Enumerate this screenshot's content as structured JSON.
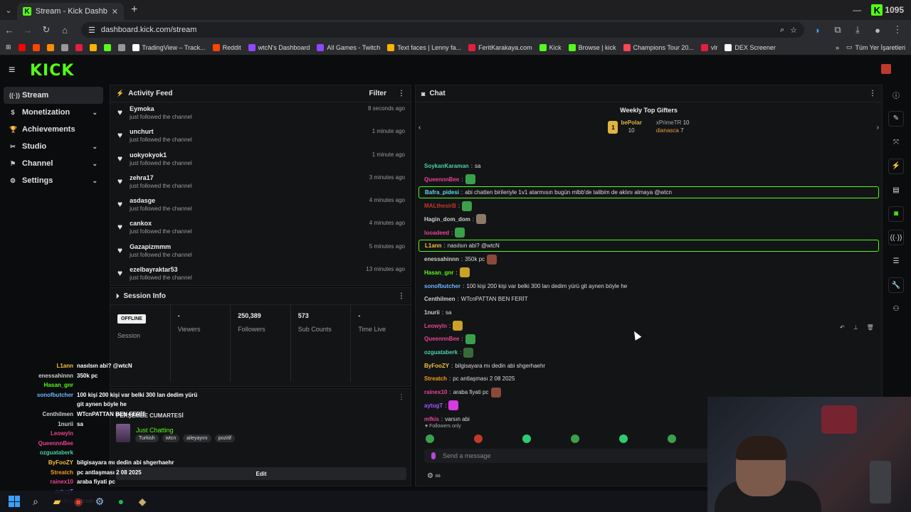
{
  "browser": {
    "tab_title": "Stream - Kick Dashboard",
    "url": "dashboard.kick.com/stream",
    "overlay_counter": "1095",
    "bookmarks": [
      {
        "label": "",
        "color": "#ff0000"
      },
      {
        "label": "",
        "color": "#ff4500"
      },
      {
        "label": "",
        "color": "#ff8c00"
      },
      {
        "label": "",
        "color": "#999999"
      },
      {
        "label": "",
        "color": "#e41e3f"
      },
      {
        "label": "",
        "color": "#f7b500"
      },
      {
        "label": "",
        "color": "#53fc18"
      },
      {
        "label": "",
        "color": "#999999"
      },
      {
        "label": "TradingView – Track...",
        "color": "#ffffff"
      },
      {
        "label": "Reddit",
        "color": "#ff4500"
      },
      {
        "label": "wtcN's Dashboard",
        "color": "#9146ff"
      },
      {
        "label": "All Games - Twitch",
        "color": "#9146ff"
      },
      {
        "label": "Text faces | Lenny fa...",
        "color": "#f7b500"
      },
      {
        "label": "FeritKarakaya.com",
        "color": "#e41e3f"
      },
      {
        "label": "Kick",
        "color": "#53fc18"
      },
      {
        "label": "Browse | kick",
        "color": "#53fc18"
      },
      {
        "label": "Champions Tour 20...",
        "color": "#ff4655"
      },
      {
        "label": "vlr",
        "color": "#e41e3f"
      },
      {
        "label": "DEX Screener",
        "color": "#ffffff"
      }
    ],
    "all_bookmarks": "Tüm Yer İşaretleri"
  },
  "kick": {
    "logo": "KICK"
  },
  "sidebar": {
    "items": [
      {
        "label": "Stream",
        "active": true,
        "chevron": false,
        "icon": "broadcast-icon"
      },
      {
        "label": "Monetization",
        "active": false,
        "chevron": true,
        "icon": "money-icon"
      },
      {
        "label": "Achievements",
        "active": false,
        "chevron": false,
        "icon": "trophy-icon"
      },
      {
        "label": "Studio",
        "active": false,
        "chevron": true,
        "icon": "tools-icon"
      },
      {
        "label": "Channel",
        "active": false,
        "chevron": true,
        "icon": "flag-icon"
      },
      {
        "label": "Settings",
        "active": false,
        "chevron": true,
        "icon": "gear-icon"
      }
    ]
  },
  "activity": {
    "title": "Activity Feed",
    "filter_label": "Filter",
    "rows": [
      {
        "user": "Eymoka",
        "action": "just followed the channel",
        "time": "8 seconds ago"
      },
      {
        "user": "unchurt",
        "action": "just followed the channel",
        "time": "1 minute ago"
      },
      {
        "user": "uokyokyok1",
        "action": "just followed the channel",
        "time": "1 minute ago"
      },
      {
        "user": "zehra17",
        "action": "just followed the channel",
        "time": "3 minutes ago"
      },
      {
        "user": "asdasge",
        "action": "just followed the channel",
        "time": "4 minutes ago"
      },
      {
        "user": "cankox",
        "action": "just followed the channel",
        "time": "4 minutes ago"
      },
      {
        "user": "Gazapizmmm",
        "action": "just followed the channel",
        "time": "5 minutes ago"
      },
      {
        "user": "ezelbayraktar53",
        "action": "just followed the channel",
        "time": "13 minutes ago"
      }
    ]
  },
  "session": {
    "title": "Session Info",
    "offline": "OFFLINE",
    "cols": [
      {
        "value": "",
        "label": "Session"
      },
      {
        "value": "-",
        "label": "Viewers"
      },
      {
        "value": "250,389",
        "label": "Followers"
      },
      {
        "value": "573",
        "label": "Sub Counts"
      },
      {
        "value": "-",
        "label": "Time Live"
      }
    ]
  },
  "stream_info": {
    "title": "PERŞEMBE CUMARTESİ",
    "category": "Just Chatting",
    "tags": [
      "Turkish",
      "wtcn",
      "aileyayını",
      "pozitif"
    ],
    "edit_label": "Edit"
  },
  "chat": {
    "title": "Chat",
    "gifters_title": "Weekly Top Gifters",
    "gifters": [
      {
        "name": "bePolar",
        "count": "10",
        "rank": "1"
      },
      {
        "name": "xPrimeTR",
        "count": "10"
      },
      {
        "name": "dianasca",
        "count": "7"
      }
    ],
    "messages": [
      {
        "user": "SoykanKaraman",
        "text": "sa",
        "color": "#4ad0a9",
        "emote": false,
        "hl": false
      },
      {
        "user": "QueennnBee",
        "text": "",
        "color": "#e84393",
        "emote": "#3aa14a",
        "hl": false
      },
      {
        "user": "Bafra_pidesi",
        "text": "abi chatten birileriyle 1v1 atarmısın bugün mlbb'de talibim de aklını almaya @wtcn",
        "color": "#5fd8e8",
        "emote": false,
        "hl": true
      },
      {
        "user": "MALthesirB",
        "text": "",
        "color": "#c0392b",
        "emote": "#3aa14a",
        "hl": false
      },
      {
        "user": "Hagin_dom_dom",
        "text": "",
        "color": "#cfcfcf",
        "emote": "#8a7a6a",
        "hl": false
      },
      {
        "user": "looadeed",
        "text": "",
        "color": "#e84393",
        "emote": "#3aa14a",
        "hl": false
      },
      {
        "user": "L1ann",
        "text": "nasılsın abi? @wtcN",
        "color": "#f0c040",
        "emote": false,
        "hl": true
      },
      {
        "user": "enessahinnn",
        "text": "350k pc",
        "color": "#cfcfcf",
        "emote": "#8a4a3a",
        "hl": false
      },
      {
        "user": "Hasan_gnr",
        "text": "",
        "color": "#53fc18",
        "emote": "#c9a227",
        "hl": false
      },
      {
        "user": "sonofbutcher",
        "text": "100 kişi 200 kişi var belki 300 lan dedim yürü git aynen böyle he",
        "color": "#6cb6ff",
        "emote": false,
        "hl": false
      },
      {
        "user": "Centhilmen",
        "text": "WTcnPATTAN BEN FERİT",
        "color": "#cfcfcf",
        "emote": false,
        "hl": false
      },
      {
        "user": "1nurii",
        "text": "sa",
        "color": "#cfcfcf",
        "emote": false,
        "hl": false
      },
      {
        "user": "Leowyln",
        "text": "",
        "color": "#e84393",
        "emote": "#c9a227",
        "hl": false
      },
      {
        "user": "QueennnBee",
        "text": "",
        "color": "#e84393",
        "emote": "#3aa14a",
        "hl": false
      },
      {
        "user": "ozguataberk",
        "text": "",
        "color": "#4ad0a9",
        "emote": "#3a6a3a",
        "hl": false
      },
      {
        "user": "ByFooZY",
        "text": "bilgisayara mı dedin abi shgerhaehr",
        "color": "#f0c040",
        "emote": false,
        "hl": false
      },
      {
        "user": "Streatch",
        "text": "pc antlaşması 2 08 2025",
        "color": "#f39c12",
        "emote": false,
        "hl": false
      },
      {
        "user": "rainex10",
        "text": "araba fiyati pc",
        "color": "#e84393",
        "emote": "#8a4a3a",
        "hl": false
      },
      {
        "user": "aytugT",
        "text": "",
        "color": "#9b59ff",
        "emote": "#d63ae0",
        "hl": false
      },
      {
        "user": "mfkis",
        "text": "varsın abi",
        "color": "#e84393",
        "emote": false,
        "hl": false
      }
    ],
    "followers_only": "Followers only",
    "placeholder": "Send a message"
  },
  "overlay_chat": [
    {
      "user": "L1ann",
      "text": "nasılsın abi? @wtcN",
      "color": "#f0c040"
    },
    {
      "user": "enessahinnn",
      "text": "350k pc",
      "color": "#cfcfcf"
    },
    {
      "user": "Hasan_gnr",
      "text": "",
      "color": "#53fc18"
    },
    {
      "user": "sonofbutcher",
      "text": "100 kişi 200 kişi var belki 300 lan dedim yürü",
      "color": "#6cb6ff"
    },
    {
      "user": "",
      "text": "git aynen böyle he",
      "color": "#6cb6ff"
    },
    {
      "user": "Centhilmen",
      "text": "WTcnPATTAN BEN FERİT",
      "color": "#cfcfcf"
    },
    {
      "user": "1nurii",
      "text": "sa",
      "color": "#cfcfcf"
    },
    {
      "user": "Leowyln",
      "text": "",
      "color": "#e84393"
    },
    {
      "user": "QueennnBee",
      "text": "",
      "color": "#e84393"
    },
    {
      "user": "ozguataberk",
      "text": "",
      "color": "#4ad0a9"
    },
    {
      "user": "ByFooZY",
      "text": "bilgisayara mı dedin abi shgerhaehr",
      "color": "#f0c040"
    },
    {
      "user": "Streatch",
      "text": "pc antlaşması 2 08 2025",
      "color": "#f39c12"
    },
    {
      "user": "rainex10",
      "text": "araba fiyati pc",
      "color": "#e84393"
    },
    {
      "user": "aytugT",
      "text": "",
      "color": "#9b59ff"
    },
    {
      "user": "mfkis",
      "text": "varsın abi",
      "color": "#e84393"
    }
  ],
  "colors": {
    "accent": "#53fc18"
  }
}
